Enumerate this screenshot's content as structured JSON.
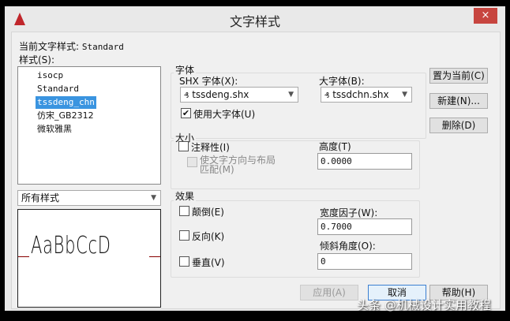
{
  "window": {
    "title": "文字样式",
    "close": "×"
  },
  "current_style": {
    "label": "当前文字样式:",
    "value": "Standard"
  },
  "styles": {
    "label": "样式(S):",
    "items": [
      "isocp",
      "Standard",
      "tssdeng_chn",
      "仿宋_GB2312",
      "微软雅黑"
    ],
    "selected": "tssdeng_chn"
  },
  "filter": {
    "value": "所有样式"
  },
  "preview": {
    "text": "AaBbCcD"
  },
  "font_group": {
    "title": "字体",
    "shx_label": "SHX 字体(X):",
    "shx_value": "tssdeng.shx",
    "big_label": "大字体(B):",
    "big_value": "tssdchn.shx",
    "use_big_label": "使用大字体(U)",
    "use_big_checked": true
  },
  "size_group": {
    "title": "大小",
    "annotative_label": "注释性(I)",
    "annotative_checked": false,
    "match_label_1": "使文字方向与布局",
    "match_label_2": "匹配(M)",
    "height_label": "高度(T)",
    "height_value": "0.0000"
  },
  "effects_group": {
    "title": "效果",
    "upside_down": "颠倒(E)",
    "backwards": "反向(K)",
    "vertical": "垂直(V)",
    "width_label": "宽度因子(W):",
    "width_value": "0.7000",
    "oblique_label": "倾斜角度(O):",
    "oblique_value": "0"
  },
  "buttons": {
    "set_current": "置为当前(C)",
    "new": "新建(N)...",
    "delete": "删除(D)",
    "apply": "应用(A)",
    "cancel": "取消",
    "help": "帮助(H)"
  },
  "watermark": "头条 @机械设计实用教程",
  "colors": {
    "selection": "#3a94e0",
    "close": "#c7453f"
  }
}
